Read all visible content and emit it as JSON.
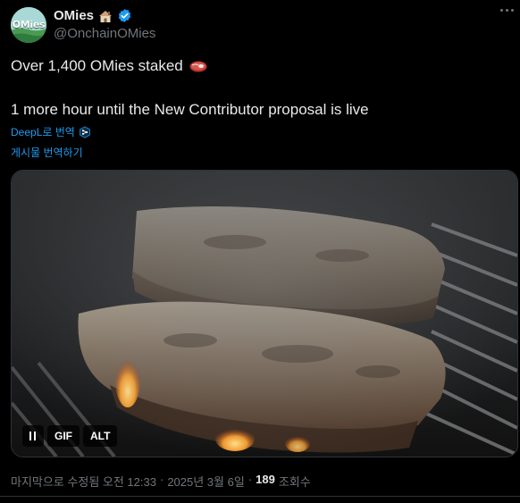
{
  "author": {
    "avatar_text": "OMies",
    "display_name": "OMies",
    "handle": "@OnchainOMies",
    "name_emoji": "house-emoji",
    "verified_icon": "verified-badge-icon",
    "verified_color": "#1d9bf0"
  },
  "tweet": {
    "line1": "Over 1,400 OMies staked",
    "line1_emoji": "steak-emoji",
    "line2": "1 more hour until the New Contributor proposal is live",
    "translate_link": "DeepL로 번역",
    "translate_icon": "deepl-icon",
    "translate_post": "게시물 번역하기"
  },
  "media": {
    "description_icon": "media-video",
    "pause_icon": "pause-icon",
    "gif_label": "GIF",
    "alt_label": "ALT"
  },
  "footer": {
    "edited_time": "마지막으로 수정됨 오전 12:33",
    "date": "2025년 3월 6일",
    "views_count": "189",
    "views_label": "조회수"
  },
  "colors": {
    "background": "#000000",
    "text_primary": "#e7e9ea",
    "text_secondary": "#71767b",
    "link": "#1d9bf0"
  }
}
